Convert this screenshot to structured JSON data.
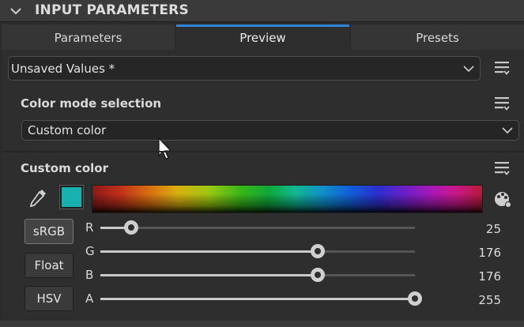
{
  "header": {
    "title": "INPUT PARAMETERS"
  },
  "tabs": [
    {
      "label": "Parameters"
    },
    {
      "label": "Preview"
    },
    {
      "label": "Presets"
    }
  ],
  "active_tab": "Preview",
  "preset_dropdown": {
    "value": "Unsaved Values *"
  },
  "color_mode": {
    "title": "Color mode selection",
    "value": "Custom color"
  },
  "custom_color": {
    "title": "Custom color",
    "swatch_color": "#19b0b0",
    "modes": [
      {
        "label": "sRGB",
        "active": true
      },
      {
        "label": "Float",
        "active": false
      },
      {
        "label": "HSV",
        "active": false
      }
    ],
    "channels": [
      {
        "label": "R",
        "value": "25",
        "fraction": 0.098
      },
      {
        "label": "G",
        "value": "176",
        "fraction": 0.69
      },
      {
        "label": "B",
        "value": "176",
        "fraction": 0.69
      },
      {
        "label": "A",
        "value": "255",
        "fraction": 1.0
      }
    ]
  },
  "colors": {
    "accent": "#2f86d6",
    "background": "#2e2e2e"
  },
  "icons": [
    "chevron-down-icon",
    "menu-icon",
    "eyedropper-icon",
    "palette-icon",
    "cursor-icon"
  ]
}
